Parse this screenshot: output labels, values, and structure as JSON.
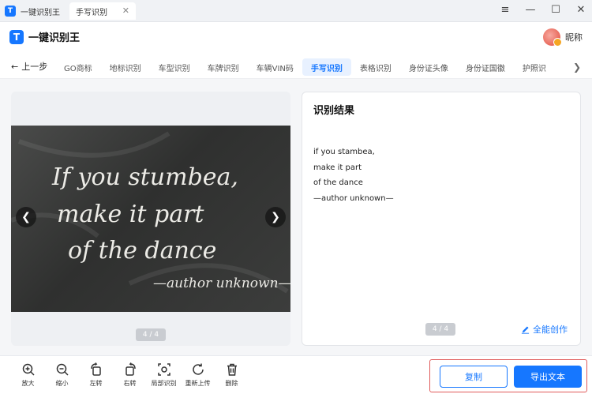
{
  "window": {
    "app_tab_label": "一键识别王",
    "doc_tab_label": "手写识别",
    "doc_tab_close": "✕",
    "controls": [
      "≡",
      "—",
      "☐",
      "✕"
    ]
  },
  "header": {
    "brand_logo": "T",
    "brand_name": "一键识别王",
    "user_name": "昵称"
  },
  "nav": {
    "back_label": "上一步",
    "back_icon": "←",
    "more_icon": "❯",
    "tabs": [
      "GO商标",
      "地标识别",
      "车型识别",
      "车牌识别",
      "车辆VIN码",
      "手写识别",
      "表格识别",
      "身份证头像",
      "身份证国徽",
      "护照识"
    ],
    "active_tab": "手写识别"
  },
  "preview": {
    "chalk_lines": [
      "If you stumbea,",
      "make it part",
      "of the dance",
      "—author unknown—"
    ],
    "prev_icon": "❮",
    "next_icon": "❯",
    "page_indicator": "4 / 4"
  },
  "result": {
    "title": "识别结果",
    "lines": [
      "if you stambea,",
      "make it part",
      "of the dance",
      "—author unknown—"
    ],
    "page_indicator": "4 / 4",
    "create_label": "全能创作"
  },
  "toolbar": {
    "tools": [
      {
        "icon": "zoom-in-icon",
        "label": "放大"
      },
      {
        "icon": "zoom-out-icon",
        "label": "缩小"
      },
      {
        "icon": "rotate-left-icon",
        "label": "左转"
      },
      {
        "icon": "rotate-right-icon",
        "label": "右转"
      },
      {
        "icon": "local-recognize-icon",
        "label": "局部识别"
      },
      {
        "icon": "reupload-icon",
        "label": "重新上传"
      },
      {
        "icon": "delete-icon",
        "label": "删除"
      }
    ],
    "copy_label": "复制",
    "export_label": "导出文本"
  },
  "colors": {
    "accent": "#1677ff",
    "highlight_border": "#e05a5a"
  }
}
